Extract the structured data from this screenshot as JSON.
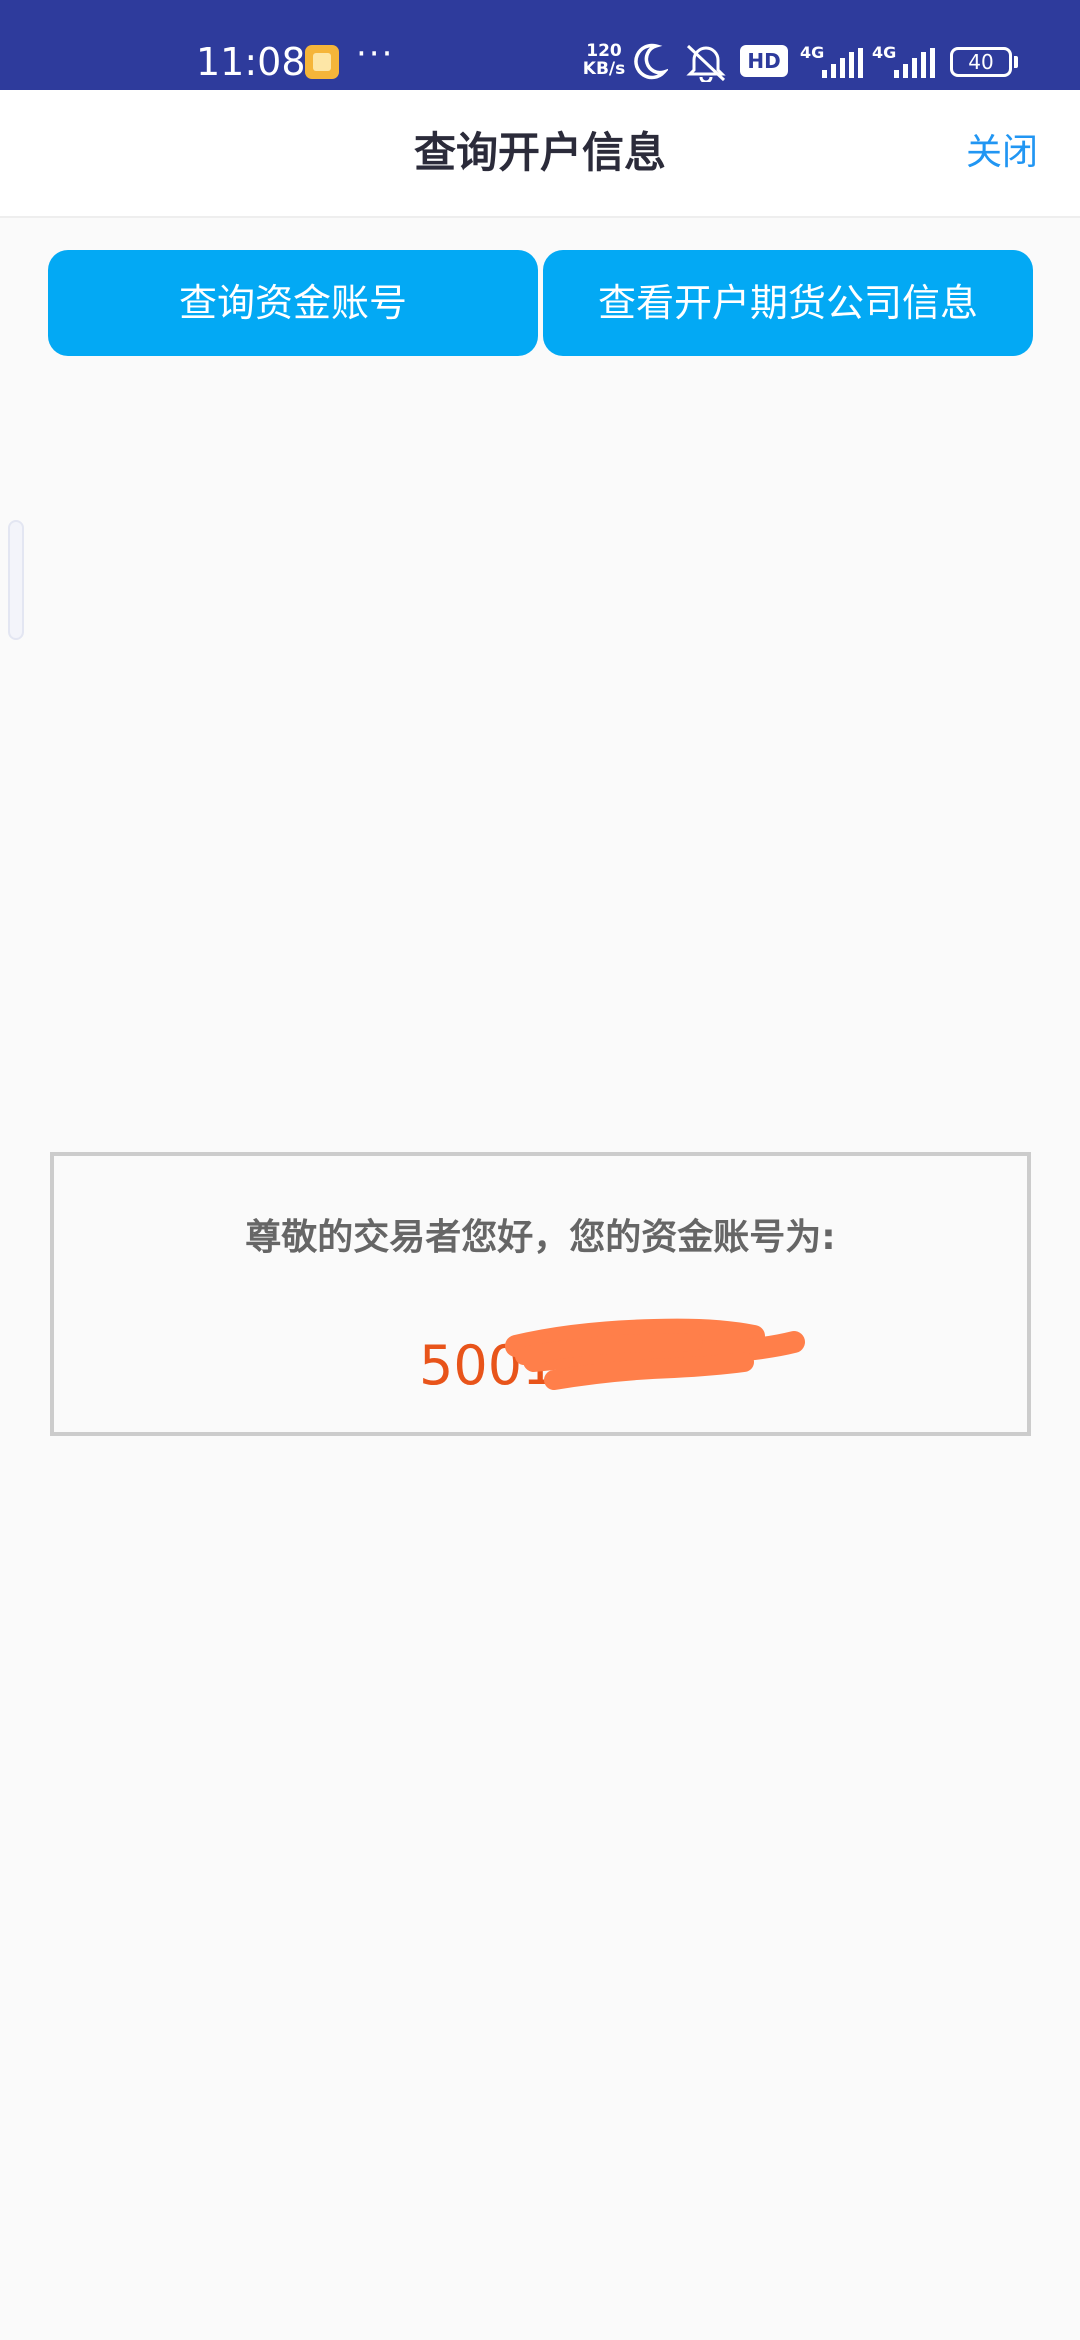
{
  "status_bar": {
    "time": "11:08",
    "more": "···",
    "net_speed_value": "120",
    "net_speed_unit": "KB/s",
    "hd_label": "HD",
    "signal1_label": "4G",
    "signal2_label": "4G",
    "battery_level": "40",
    "background_color": "#2e3b9c"
  },
  "header": {
    "title": "查询开户信息",
    "close_label": "关闭"
  },
  "actions": {
    "query_account_label": "查询资金账号",
    "view_company_label": "查看开户期货公司信息",
    "button_color": "#03a9f4"
  },
  "result": {
    "greeting": "尊敬的交易者您好，您的资金账号为:",
    "account_number": "5001",
    "account_number_color": "#e8541a",
    "redaction_color": "#ff7f4a"
  }
}
